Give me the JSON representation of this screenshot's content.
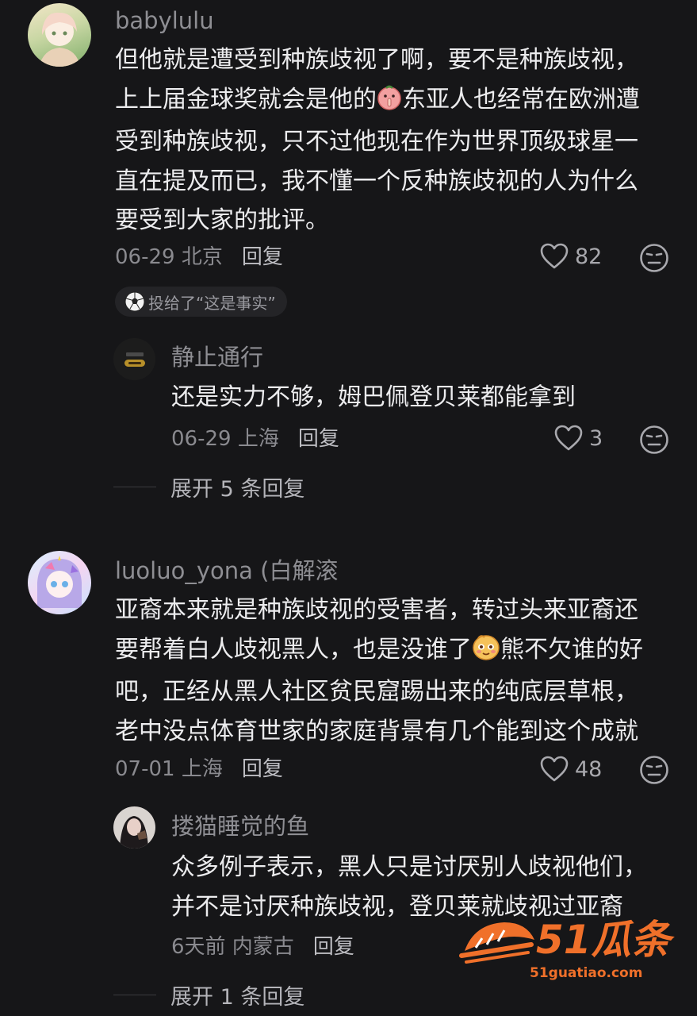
{
  "comments": [
    {
      "username": "babylulu",
      "text_1": "但他就是遭受到种族歧视了啊，要不是种族歧视，",
      "text_2a": "上上届金球奖就会是他的",
      "text_2b": "东亚人也经常在欧洲遭",
      "text_3": "受到种族歧视，只不过他现在作为世界顶级球星一",
      "text_4": "直在提及而已，我不懂一个反种族歧视的人为什么",
      "text_5": "要受到大家的批评。",
      "date_location": "06-29 北京",
      "reply_label": "回复",
      "likes": "82",
      "vote_badge": "投给了“这是事实”",
      "replies": [
        {
          "username": "静止通行",
          "text": "还是实力不够，姆巴佩登贝莱都能拿到",
          "date_location": "06-29 上海",
          "reply_label": "回复",
          "likes": "3"
        }
      ],
      "expand_label": "展开 5 条回复"
    },
    {
      "username": "luoluo_yona (白解滚",
      "text_1": "亚裔本来就是种族歧视的受害者，转过头来亚裔还",
      "text_2a": "要帮着白人歧视黑人，也是没谁了",
      "text_2b": "熊不欠谁的好",
      "text_3": "吧，正经从黑人社区贫民窟踢出来的纯底层草根，",
      "text_4": "老中没点体育世家的家庭背景有几个能到这个成就",
      "date_location": "07-01 上海",
      "reply_label": "回复",
      "likes": "48",
      "replies": [
        {
          "username": "搂猫睡觉的鱼",
          "text_1": "众多例子表示，黑人只是讨厌别人歧视他们，",
          "text_2": "并不是讨厌种族歧视，登贝莱就歧视过亚裔",
          "date_location": "6天前 内蒙古",
          "reply_label": "回复"
        }
      ],
      "expand_label": "展开 1 条回复"
    }
  ],
  "watermark": {
    "brand": "51瓜条",
    "url": "51guatiao.com"
  },
  "colors": {
    "background": "#161618",
    "username": "#8e8e93",
    "watermark": "#f0702a"
  }
}
